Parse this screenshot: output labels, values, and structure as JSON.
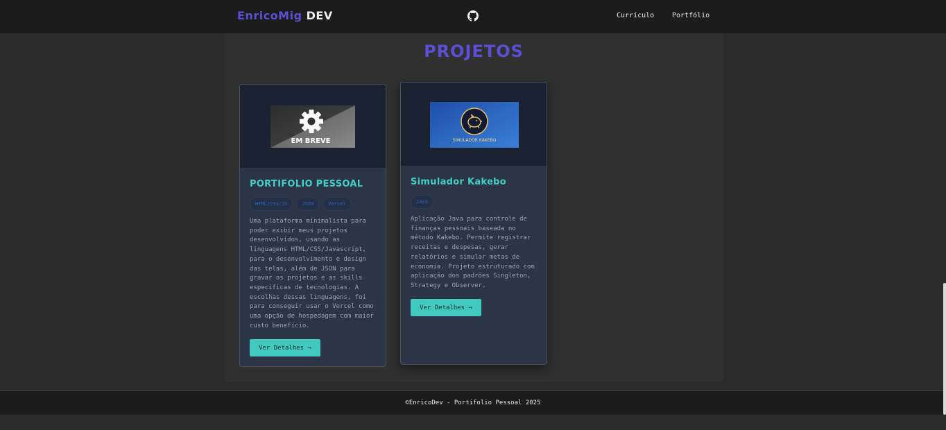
{
  "header": {
    "brand_part1": "EnricoMig",
    "brand_part2": "DEV",
    "nav": [
      "Currículo",
      "Portfólio"
    ],
    "github_icon": "github-icon"
  },
  "section": {
    "title": "PROJETOS"
  },
  "projects": [
    {
      "thumbnail_text": "EM BREVE",
      "thumbnail_icon": "gear-icon",
      "title": "PORTIFOLIO PESSOAL",
      "tags": [
        "HTML/CSS/JS",
        "JSON",
        "Vercel"
      ],
      "description": "Uma plataforma minimalista para poder exibir meus projetos desenvolvidos, usando as linguagens HTML/CSS/Javascript, para o desenvolvimento e design das telas, além de JSON para gravar os projetos e as skills especificas de tecnologias. A escolhas dessas linguagens, foi para conseguir usar o Vercel como uma opção de hospedagem com maior custo benefício.",
      "button": "Ver Detalhes →"
    },
    {
      "thumbnail_text": "SIMULADOR KAKEBO",
      "thumbnail_icon": "piggy-bank-icon",
      "title": "Simulador Kakebo",
      "tags": [
        "Java"
      ],
      "description": "Aplicação Java para controle de finanças pessoais baseada no método Kakebo. Permite registrar receitas e despesas, gerar relatórios e simular metas de economia. Projeto estruturado com aplicação dos padrões Singleton, Strategy e Observer.",
      "button": "Ver Detalhes →"
    }
  ],
  "footer": {
    "text": "©EnricoDev - Portifolio Pessoal 2025"
  },
  "colors": {
    "accent": "#5b4fd6",
    "teal": "#41d0c4",
    "button": "#41c9bf",
    "card": "#2b3546",
    "background": "#2b2b2b"
  }
}
